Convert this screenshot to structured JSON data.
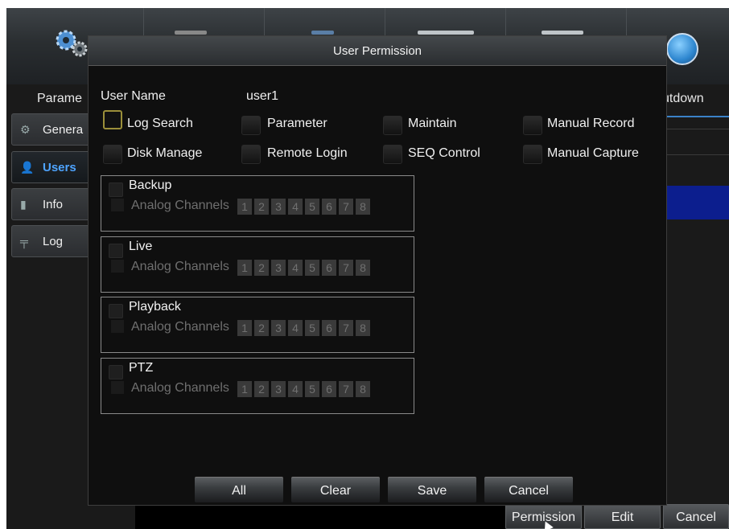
{
  "background": {
    "header_left_label": "Parame",
    "header_right_label": "utdown",
    "sidebar": [
      {
        "label": "Genera",
        "icon": "gear-icon"
      },
      {
        "label": "Users",
        "icon": "user-icon"
      },
      {
        "label": "Info",
        "icon": "info-icon"
      },
      {
        "label": "Log",
        "icon": "log-icon"
      }
    ],
    "bottom_buttons": [
      "Permission",
      "Edit",
      "Cancel"
    ]
  },
  "dialog": {
    "title": "User Permission",
    "user_name_label": "User Name",
    "user_name_value": "user1",
    "permissions": [
      "Log Search",
      "Parameter",
      "Maintain",
      "Manual Record",
      "Disk Manage",
      "Remote Login",
      "SEQ Control",
      "Manual Capture"
    ],
    "groups": [
      {
        "title": "Backup"
      },
      {
        "title": "Live"
      },
      {
        "title": "Playback"
      },
      {
        "title": "PTZ"
      }
    ],
    "channels_label": "Analog Channels",
    "channel_numbers": [
      "1",
      "2",
      "3",
      "4",
      "5",
      "6",
      "7",
      "8"
    ],
    "buttons": {
      "all": "All",
      "clear": "Clear",
      "save": "Save",
      "cancel": "Cancel"
    }
  },
  "colors": {
    "accent_blue": "#4ea4ff",
    "selected_row": "#0c1e8e",
    "focus_border": "#9b8f3a"
  }
}
